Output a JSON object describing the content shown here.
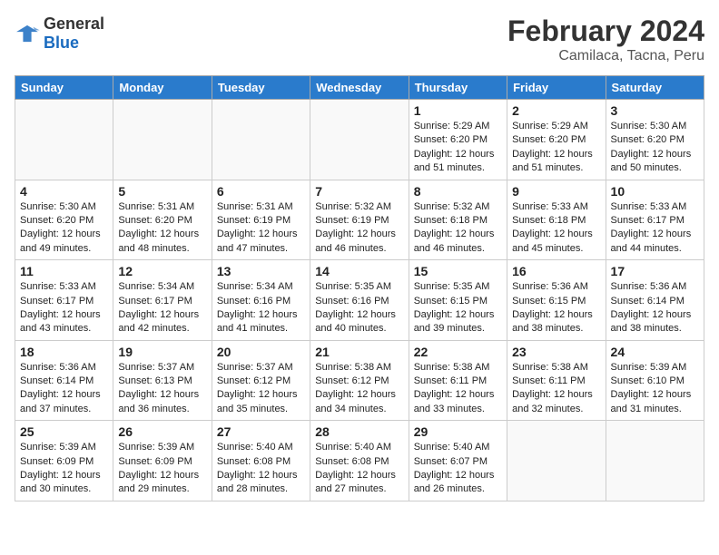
{
  "header": {
    "logo": {
      "general": "General",
      "blue": "Blue"
    },
    "title": "February 2024",
    "subtitle": "Camilaca, Tacna, Peru"
  },
  "days_of_week": [
    "Sunday",
    "Monday",
    "Tuesday",
    "Wednesday",
    "Thursday",
    "Friday",
    "Saturday"
  ],
  "weeks": [
    [
      {
        "day": "",
        "info": ""
      },
      {
        "day": "",
        "info": ""
      },
      {
        "day": "",
        "info": ""
      },
      {
        "day": "",
        "info": ""
      },
      {
        "day": "1",
        "info": "Sunrise: 5:29 AM\nSunset: 6:20 PM\nDaylight: 12 hours\nand 51 minutes."
      },
      {
        "day": "2",
        "info": "Sunrise: 5:29 AM\nSunset: 6:20 PM\nDaylight: 12 hours\nand 51 minutes."
      },
      {
        "day": "3",
        "info": "Sunrise: 5:30 AM\nSunset: 6:20 PM\nDaylight: 12 hours\nand 50 minutes."
      }
    ],
    [
      {
        "day": "4",
        "info": "Sunrise: 5:30 AM\nSunset: 6:20 PM\nDaylight: 12 hours\nand 49 minutes."
      },
      {
        "day": "5",
        "info": "Sunrise: 5:31 AM\nSunset: 6:20 PM\nDaylight: 12 hours\nand 48 minutes."
      },
      {
        "day": "6",
        "info": "Sunrise: 5:31 AM\nSunset: 6:19 PM\nDaylight: 12 hours\nand 47 minutes."
      },
      {
        "day": "7",
        "info": "Sunrise: 5:32 AM\nSunset: 6:19 PM\nDaylight: 12 hours\nand 46 minutes."
      },
      {
        "day": "8",
        "info": "Sunrise: 5:32 AM\nSunset: 6:18 PM\nDaylight: 12 hours\nand 46 minutes."
      },
      {
        "day": "9",
        "info": "Sunrise: 5:33 AM\nSunset: 6:18 PM\nDaylight: 12 hours\nand 45 minutes."
      },
      {
        "day": "10",
        "info": "Sunrise: 5:33 AM\nSunset: 6:17 PM\nDaylight: 12 hours\nand 44 minutes."
      }
    ],
    [
      {
        "day": "11",
        "info": "Sunrise: 5:33 AM\nSunset: 6:17 PM\nDaylight: 12 hours\nand 43 minutes."
      },
      {
        "day": "12",
        "info": "Sunrise: 5:34 AM\nSunset: 6:17 PM\nDaylight: 12 hours\nand 42 minutes."
      },
      {
        "day": "13",
        "info": "Sunrise: 5:34 AM\nSunset: 6:16 PM\nDaylight: 12 hours\nand 41 minutes."
      },
      {
        "day": "14",
        "info": "Sunrise: 5:35 AM\nSunset: 6:16 PM\nDaylight: 12 hours\nand 40 minutes."
      },
      {
        "day": "15",
        "info": "Sunrise: 5:35 AM\nSunset: 6:15 PM\nDaylight: 12 hours\nand 39 minutes."
      },
      {
        "day": "16",
        "info": "Sunrise: 5:36 AM\nSunset: 6:15 PM\nDaylight: 12 hours\nand 38 minutes."
      },
      {
        "day": "17",
        "info": "Sunrise: 5:36 AM\nSunset: 6:14 PM\nDaylight: 12 hours\nand 38 minutes."
      }
    ],
    [
      {
        "day": "18",
        "info": "Sunrise: 5:36 AM\nSunset: 6:14 PM\nDaylight: 12 hours\nand 37 minutes."
      },
      {
        "day": "19",
        "info": "Sunrise: 5:37 AM\nSunset: 6:13 PM\nDaylight: 12 hours\nand 36 minutes."
      },
      {
        "day": "20",
        "info": "Sunrise: 5:37 AM\nSunset: 6:12 PM\nDaylight: 12 hours\nand 35 minutes."
      },
      {
        "day": "21",
        "info": "Sunrise: 5:38 AM\nSunset: 6:12 PM\nDaylight: 12 hours\nand 34 minutes."
      },
      {
        "day": "22",
        "info": "Sunrise: 5:38 AM\nSunset: 6:11 PM\nDaylight: 12 hours\nand 33 minutes."
      },
      {
        "day": "23",
        "info": "Sunrise: 5:38 AM\nSunset: 6:11 PM\nDaylight: 12 hours\nand 32 minutes."
      },
      {
        "day": "24",
        "info": "Sunrise: 5:39 AM\nSunset: 6:10 PM\nDaylight: 12 hours\nand 31 minutes."
      }
    ],
    [
      {
        "day": "25",
        "info": "Sunrise: 5:39 AM\nSunset: 6:09 PM\nDaylight: 12 hours\nand 30 minutes."
      },
      {
        "day": "26",
        "info": "Sunrise: 5:39 AM\nSunset: 6:09 PM\nDaylight: 12 hours\nand 29 minutes."
      },
      {
        "day": "27",
        "info": "Sunrise: 5:40 AM\nSunset: 6:08 PM\nDaylight: 12 hours\nand 28 minutes."
      },
      {
        "day": "28",
        "info": "Sunrise: 5:40 AM\nSunset: 6:08 PM\nDaylight: 12 hours\nand 27 minutes."
      },
      {
        "day": "29",
        "info": "Sunrise: 5:40 AM\nSunset: 6:07 PM\nDaylight: 12 hours\nand 26 minutes."
      },
      {
        "day": "",
        "info": ""
      },
      {
        "day": "",
        "info": ""
      }
    ]
  ]
}
